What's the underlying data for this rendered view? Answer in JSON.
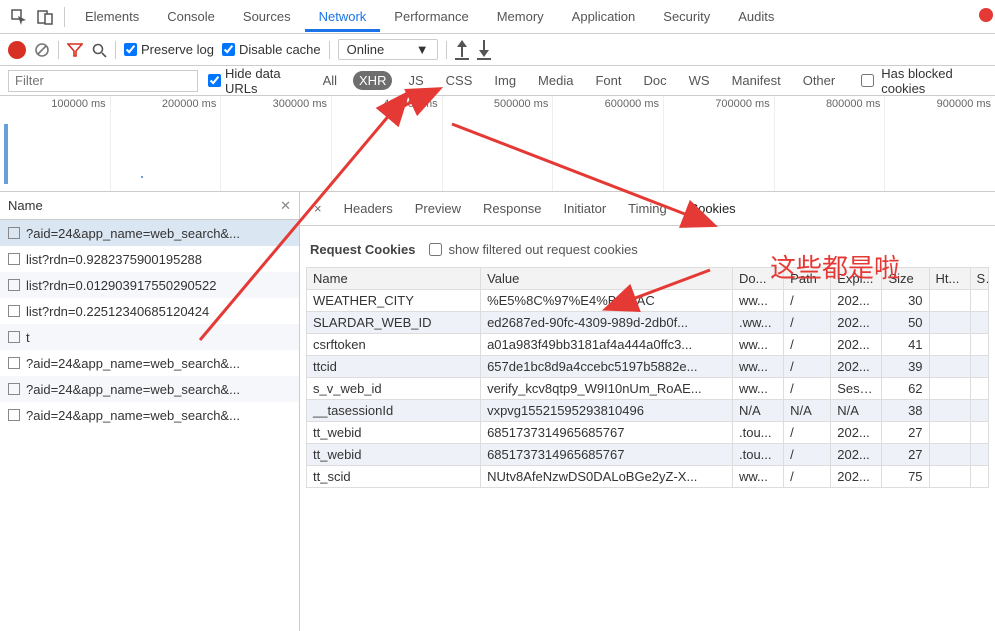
{
  "devtools_tabs": {
    "elements": "Elements",
    "console": "Console",
    "sources": "Sources",
    "network": "Network",
    "performance": "Performance",
    "memory": "Memory",
    "application": "Application",
    "security": "Security",
    "audits": "Audits"
  },
  "toolbar": {
    "preserve_log": "Preserve log",
    "disable_cache": "Disable cache",
    "online": "Online"
  },
  "filter": {
    "placeholder": "Filter",
    "hide_data_urls": "Hide data URLs",
    "types": {
      "all": "All",
      "xhr": "XHR",
      "js": "JS",
      "css": "CSS",
      "img": "Img",
      "media": "Media",
      "font": "Font",
      "doc": "Doc",
      "ws": "WS",
      "manifest": "Manifest",
      "other": "Other"
    },
    "has_blocked_cookies": "Has blocked cookies"
  },
  "timeline_ticks": [
    "100000 ms",
    "200000 ms",
    "300000 ms",
    "400000 ms",
    "500000 ms",
    "600000 ms",
    "700000 ms",
    "800000 ms",
    "900000 ms"
  ],
  "left": {
    "title": "Name",
    "requests": [
      "?aid=24&app_name=web_search&...",
      "list?rdn=0.9282375900195288",
      "list?rdn=0.012903917550290522",
      "list?rdn=0.22512340685120424",
      "t",
      "?aid=24&app_name=web_search&...",
      "?aid=24&app_name=web_search&...",
      "?aid=24&app_name=web_search&..."
    ],
    "selected_index": 0
  },
  "subtabs": {
    "headers": "Headers",
    "preview": "Preview",
    "response": "Response",
    "initiator": "Initiator",
    "timing": "Timing",
    "cookies": "Cookies"
  },
  "cookies_panel": {
    "request_cookies": "Request Cookies",
    "show_filtered": "show filtered out request cookies",
    "columns": {
      "name": "Name",
      "value": "Value",
      "domain": "Do...",
      "path": "Path",
      "expires": "Expi...",
      "size": "Size",
      "http": "Ht...",
      "s": "S"
    },
    "rows": [
      {
        "name": "WEATHER_CITY",
        "value": "%E5%8C%97%E4%BA%AC",
        "domain": "ww...",
        "path": "/",
        "expires": "202...",
        "size": "30",
        "http": "",
        "s": ""
      },
      {
        "name": "SLARDAR_WEB_ID",
        "value": "ed2687ed-90fc-4309-989d-2db0f...",
        "domain": ".ww...",
        "path": "/",
        "expires": "202...",
        "size": "50",
        "http": "",
        "s": ""
      },
      {
        "name": "csrftoken",
        "value": "a01a983f49bb3181af4a444a0ffc3...",
        "domain": "ww...",
        "path": "/",
        "expires": "202...",
        "size": "41",
        "http": "",
        "s": ""
      },
      {
        "name": "ttcid",
        "value": "657de1bc8d9a4ccebc5197b5882e...",
        "domain": "ww...",
        "path": "/",
        "expires": "202...",
        "size": "39",
        "http": "",
        "s": ""
      },
      {
        "name": "s_v_web_id",
        "value": "verify_kcv8qtp9_W9I10nUm_RoAE...",
        "domain": "ww...",
        "path": "/",
        "expires": "Sess...",
        "size": "62",
        "http": "",
        "s": ""
      },
      {
        "name": "__tasessionId",
        "value": "vxpvg15521595293810496",
        "domain": "N/A",
        "path": "N/A",
        "expires": "N/A",
        "size": "38",
        "http": "",
        "s": ""
      },
      {
        "name": "tt_webid",
        "value": "6851737314965685767",
        "domain": ".tou...",
        "path": "/",
        "expires": "202...",
        "size": "27",
        "http": "",
        "s": ""
      },
      {
        "name": "tt_webid",
        "value": "6851737314965685767",
        "domain": ".tou...",
        "path": "/",
        "expires": "202...",
        "size": "27",
        "http": "",
        "s": ""
      },
      {
        "name": "tt_scid",
        "value": "NUtv8AfeNzwDS0DALoBGe2yZ-X...",
        "domain": "ww...",
        "path": "/",
        "expires": "202...",
        "size": "75",
        "http": "",
        "s": ""
      }
    ]
  },
  "annotation_text": "这些都是啦"
}
